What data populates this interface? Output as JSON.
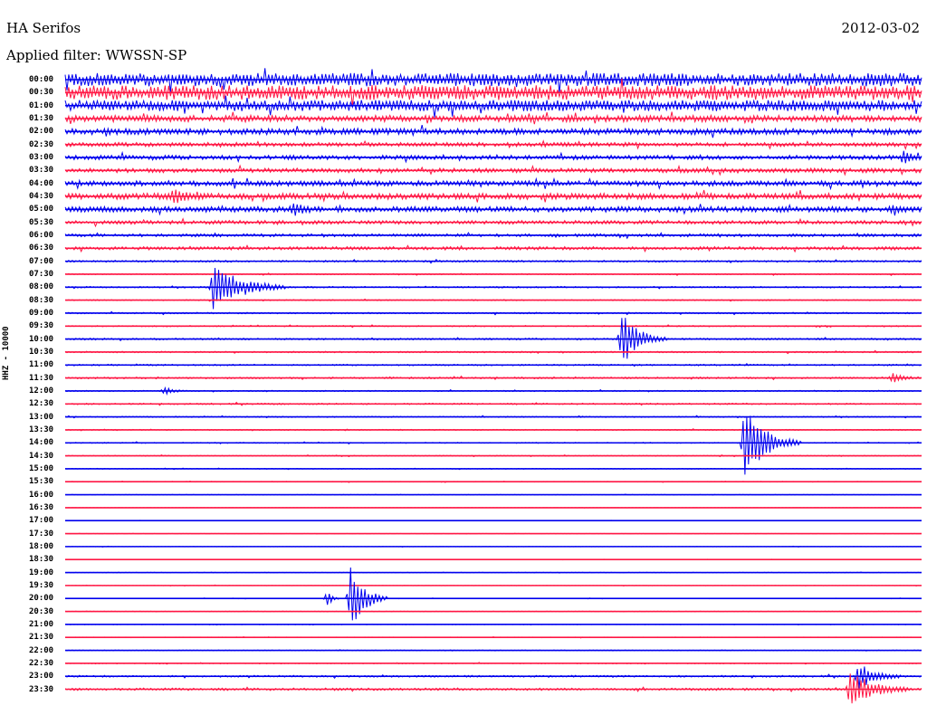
{
  "header": {
    "station": "HA Serifos",
    "date": "2012-03-02",
    "filter": "Applied filter: WWSSN-SP",
    "channel": "HHZ - 10000"
  },
  "colors": {
    "blue_trace": "#0000ee",
    "red_trace": "#ff1744"
  },
  "chart_data": {
    "type": "line",
    "title": "HA Serifos",
    "subtitle": "Applied filter: WWSSN-SP",
    "date": "2012-03-02",
    "ylabel": "HHZ - 10000",
    "grid": false,
    "legend": "none",
    "row_minutes": 30,
    "rows": [
      {
        "time": "00:00",
        "color": "blue",
        "noise": 0.9
      },
      {
        "time": "00:30",
        "color": "red",
        "noise": 1.0
      },
      {
        "time": "01:00",
        "color": "blue",
        "noise": 0.75
      },
      {
        "time": "01:30",
        "color": "red",
        "noise": 0.45
      },
      {
        "time": "02:00",
        "color": "blue",
        "noise": 0.42
      },
      {
        "time": "02:30",
        "color": "red",
        "noise": 0.28
      },
      {
        "time": "03:00",
        "color": "blue",
        "noise": 0.3
      },
      {
        "time": "03:30",
        "color": "red",
        "noise": 0.3
      },
      {
        "time": "04:00",
        "color": "blue",
        "noise": 0.35
      },
      {
        "time": "04:30",
        "color": "red",
        "noise": 0.42
      },
      {
        "time": "05:00",
        "color": "blue",
        "noise": 0.38
      },
      {
        "time": "05:30",
        "color": "red",
        "noise": 0.25
      },
      {
        "time": "06:00",
        "color": "blue",
        "noise": 0.2
      },
      {
        "time": "06:30",
        "color": "red",
        "noise": 0.22
      },
      {
        "time": "07:00",
        "color": "blue",
        "noise": 0.12
      },
      {
        "time": "07:30",
        "color": "red",
        "noise": 0.08
      },
      {
        "time": "08:00",
        "color": "blue",
        "noise": 0.1
      },
      {
        "time": "08:30",
        "color": "red",
        "noise": 0.08
      },
      {
        "time": "09:00",
        "color": "blue",
        "noise": 0.1
      },
      {
        "time": "09:30",
        "color": "red",
        "noise": 0.08
      },
      {
        "time": "10:00",
        "color": "blue",
        "noise": 0.12
      },
      {
        "time": "10:30",
        "color": "red",
        "noise": 0.1
      },
      {
        "time": "11:00",
        "color": "blue",
        "noise": 0.1
      },
      {
        "time": "11:30",
        "color": "red",
        "noise": 0.12
      },
      {
        "time": "12:00",
        "color": "blue",
        "noise": 0.08
      },
      {
        "time": "12:30",
        "color": "red",
        "noise": 0.1
      },
      {
        "time": "13:00",
        "color": "blue",
        "noise": 0.08
      },
      {
        "time": "13:30",
        "color": "red",
        "noise": 0.07
      },
      {
        "time": "14:00",
        "color": "blue",
        "noise": 0.07
      },
      {
        "time": "14:30",
        "color": "red",
        "noise": 0.06
      },
      {
        "time": "15:00",
        "color": "blue",
        "noise": 0.05
      },
      {
        "time": "15:30",
        "color": "red",
        "noise": 0.05
      },
      {
        "time": "16:00",
        "color": "blue",
        "noise": 0.03
      },
      {
        "time": "16:30",
        "color": "red",
        "noise": 0.02
      },
      {
        "time": "17:00",
        "color": "blue",
        "noise": 0.02
      },
      {
        "time": "17:30",
        "color": "red",
        "noise": 0.02
      },
      {
        "time": "18:00",
        "color": "blue",
        "noise": 0.03
      },
      {
        "time": "18:30",
        "color": "red",
        "noise": 0.02
      },
      {
        "time": "19:00",
        "color": "blue",
        "noise": 0.03
      },
      {
        "time": "19:30",
        "color": "red",
        "noise": 0.03
      },
      {
        "time": "20:00",
        "color": "blue",
        "noise": 0.03
      },
      {
        "time": "20:30",
        "color": "red",
        "noise": 0.03
      },
      {
        "time": "21:00",
        "color": "blue",
        "noise": 0.04
      },
      {
        "time": "21:30",
        "color": "red",
        "noise": 0.04
      },
      {
        "time": "22:00",
        "color": "blue",
        "noise": 0.05
      },
      {
        "time": "22:30",
        "color": "red",
        "noise": 0.06
      },
      {
        "time": "23:00",
        "color": "blue",
        "noise": 0.12
      },
      {
        "time": "23:30",
        "color": "red",
        "noise": 0.16
      }
    ],
    "events": [
      {
        "row": "08:00",
        "minute": 5.2,
        "amplitude": 3.2,
        "duration_min": 2.5
      },
      {
        "row": "10:00",
        "minute": 19.5,
        "amplitude": 3.4,
        "duration_min": 1.5
      },
      {
        "row": "14:00",
        "minute": 23.8,
        "amplitude": 4.5,
        "duration_min": 2.0
      },
      {
        "row": "20:00",
        "minute": 10.0,
        "amplitude": 4.2,
        "duration_min": 1.3
      },
      {
        "row": "20:00",
        "minute": 9.2,
        "amplitude": 1.0,
        "duration_min": 0.4
      },
      {
        "row": "23:30",
        "minute": 27.5,
        "amplitude": 2.4,
        "duration_min": 2.0
      },
      {
        "row": "23:00",
        "minute": 27.8,
        "amplitude": 1.6,
        "duration_min": 1.5
      },
      {
        "row": "03:00",
        "minute": 29.4,
        "amplitude": 0.8,
        "duration_min": 0.8
      },
      {
        "row": "04:30",
        "minute": 3.8,
        "amplitude": 0.9,
        "duration_min": 1.0
      },
      {
        "row": "11:30",
        "minute": 29.0,
        "amplitude": 0.6,
        "duration_min": 0.9
      },
      {
        "row": "12:00",
        "minute": 3.5,
        "amplitude": 0.4,
        "duration_min": 0.8
      },
      {
        "row": "05:00",
        "minute": 8.0,
        "amplitude": 0.8,
        "duration_min": 0.8
      },
      {
        "row": "05:00",
        "minute": 29.0,
        "amplitude": 0.6,
        "duration_min": 0.8
      }
    ]
  }
}
